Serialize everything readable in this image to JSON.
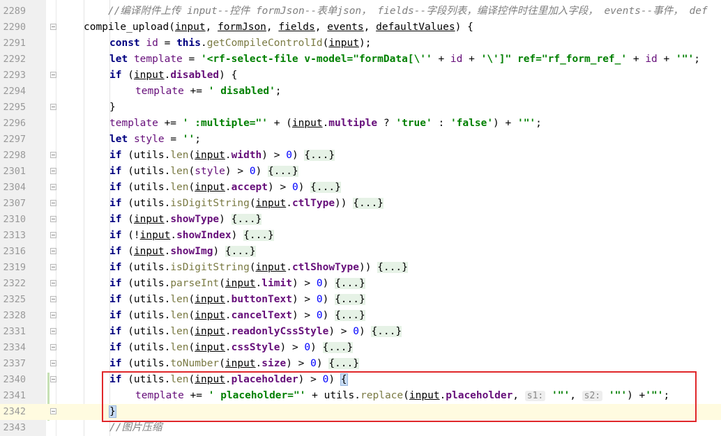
{
  "editor": {
    "lines": [
      {
        "num": "2289",
        "code": "    //编译附件上传 input--控件 formJson--表单json， fields--字段列表，编译控件时往里加入字段， events--事件， def"
      },
      {
        "num": "2290",
        "code": "compile_upload(input, formJson, fields, events, defaultValues) {"
      },
      {
        "num": "2291",
        "code": "const id = this.getCompileControlId(input);"
      },
      {
        "num": "2292",
        "code": "let template = '<rf-select-file v-model=\"formData[\\'' + id + '\\']\" ref=\"rf_form_ref_' + id + '\"';"
      },
      {
        "num": "2293",
        "code": "if (input.disabled) {"
      },
      {
        "num": "2294",
        "code": "template += ' disabled';"
      },
      {
        "num": "2295",
        "code": "}"
      },
      {
        "num": "2296",
        "code": "template += ' :multiple=\"' + (input.multiple ? 'true' : 'false') + '\"';"
      },
      {
        "num": "2297",
        "code": "let style = '';"
      },
      {
        "num": "2298",
        "code": "if (utils.len(input.width) > 0) {...}"
      },
      {
        "num": "2301",
        "code": "if (utils.len(style) > 0) {...}"
      },
      {
        "num": "2304",
        "code": "if (utils.len(input.accept) > 0) {...}"
      },
      {
        "num": "2307",
        "code": "if (utils.isDigitString(input.ctlType)) {...}"
      },
      {
        "num": "2310",
        "code": "if (input.showType) {...}"
      },
      {
        "num": "2313",
        "code": "if (!input.showIndex) {...}"
      },
      {
        "num": "2316",
        "code": "if (input.showImg) {...}"
      },
      {
        "num": "2319",
        "code": "if (utils.isDigitString(input.ctlShowType)) {...}"
      },
      {
        "num": "2322",
        "code": "if (utils.parseInt(input.limit) > 0) {...}"
      },
      {
        "num": "2325",
        "code": "if (utils.len(input.buttonText) > 0) {...}"
      },
      {
        "num": "2328",
        "code": "if (utils.len(input.cancelText) > 0) {...}"
      },
      {
        "num": "2331",
        "code": "if (utils.len(input.readonlyCssStyle) > 0) {...}"
      },
      {
        "num": "2334",
        "code": "if (utils.len(input.cssStyle) > 0) {...}"
      },
      {
        "num": "2337",
        "code": "if (utils.toNumber(input.size) > 0) {...}"
      },
      {
        "num": "2340",
        "code": "if (utils.len(input.placeholder) > 0) {"
      },
      {
        "num": "2341",
        "code": "template += ' placeholder=\"' + utils.replace(input.placeholder, s1: '\"', s2: '\"') +'\"';"
      },
      {
        "num": "2342",
        "code": "}"
      },
      {
        "num": "2343",
        "code": "//图片压缩"
      }
    ],
    "hint_s1": "s1:",
    "hint_s2": "s2:"
  }
}
